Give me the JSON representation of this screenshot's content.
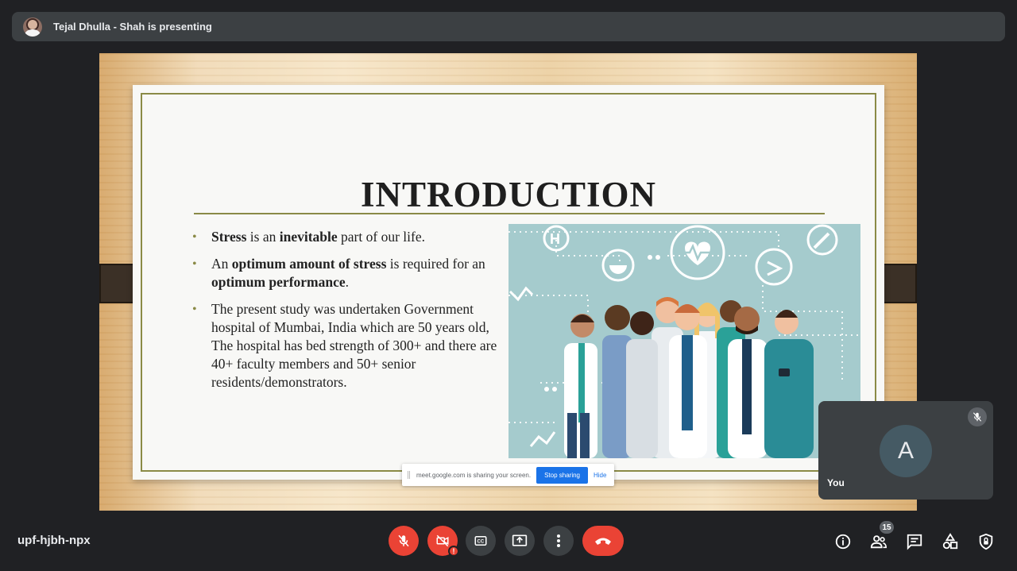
{
  "presenter_bar": {
    "text": "Tejal Dhulla - Shah is presenting"
  },
  "slide": {
    "title": "INTRODUCTION",
    "bullets": [
      {
        "segments": [
          {
            "text": "Stress",
            "bold": true
          },
          {
            "text": " is an ",
            "bold": false
          },
          {
            "text": "inevitable",
            "bold": true
          },
          {
            "text": " part of our life.",
            "bold": false
          }
        ]
      },
      {
        "segments": [
          {
            "text": "An ",
            "bold": false
          },
          {
            "text": "optimum amount of stress",
            "bold": true
          },
          {
            "text": " is required for an ",
            "bold": false
          },
          {
            "text": "optimum performance",
            "bold": true
          },
          {
            "text": ".",
            "bold": false
          }
        ]
      },
      {
        "segments": [
          {
            "text": "The present study was undertaken Government hospital of Mumbai, India which are 50 years old, The hospital has bed strength of 300+ and there are 40+ faculty members and 50+ senior residents/demonstrators.",
            "bold": false
          }
        ]
      }
    ],
    "illustration_bg": "#a5cbcd",
    "accent": "#8a8a46"
  },
  "share_banner": {
    "text": "meet.google.com is sharing your screen.",
    "stop_label": "Stop sharing",
    "hide_label": "Hide"
  },
  "self_tile": {
    "initial": "A",
    "name": "You"
  },
  "meeting_code": "upf-hjbh-npx",
  "controls": {
    "mic": {
      "icon": "mic-off-icon",
      "state": "off"
    },
    "camera": {
      "icon": "camera-off-icon",
      "state": "off",
      "alert": "!"
    },
    "captions": {
      "icon": "captions-icon"
    },
    "present": {
      "icon": "present-screen-icon"
    },
    "more": {
      "icon": "more-vert-icon"
    },
    "end_call": {
      "icon": "end-call-icon"
    }
  },
  "right_controls": {
    "people_count": "15",
    "icons": [
      "info-icon",
      "people-icon",
      "chat-icon",
      "activities-icon",
      "host-controls-icon"
    ]
  },
  "colors": {
    "end_red": "#ea4335",
    "stop_blue": "#1a73e8",
    "bar_bg": "#3c4043",
    "page_bg": "#202124"
  }
}
